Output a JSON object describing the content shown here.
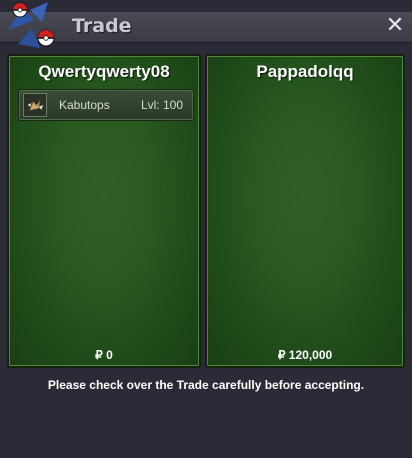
{
  "window": {
    "title": "Trade",
    "close_label": "✕"
  },
  "left_panel": {
    "player_name": "Qwertyqwerty08",
    "offer_items": [
      {
        "name": "Kabutops",
        "level": "Lvl: 100",
        "icon": "kabutops-sprite-icon"
      }
    ],
    "money_symbol": "₽",
    "money": "0"
  },
  "right_panel": {
    "player_name": "Pappadolqq",
    "offer_items": [],
    "money_symbol": "₽",
    "money": "120,000"
  },
  "footer": {
    "notice": "Please check over the Trade carefully before accepting."
  },
  "colors": {
    "panel_green": "#2a5a20",
    "window_bg": "#2b2a37",
    "titlebar": "#44444e",
    "text": "#ffffff"
  }
}
